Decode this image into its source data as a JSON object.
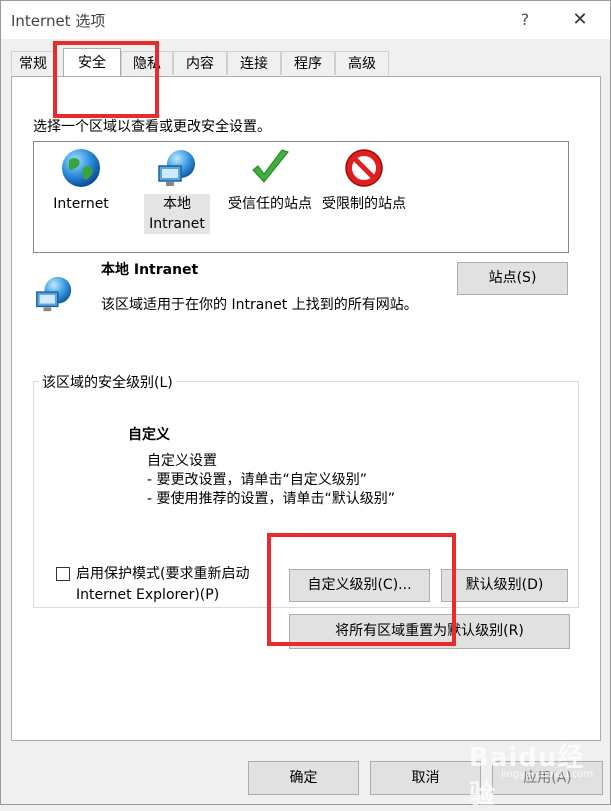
{
  "window": {
    "title": "Internet 选项",
    "help_glyph": "?",
    "close_glyph": "✕"
  },
  "tabs": [
    {
      "label": "常规"
    },
    {
      "label": "安全"
    },
    {
      "label": "隐私"
    },
    {
      "label": "内容"
    },
    {
      "label": "连接"
    },
    {
      "label": "程序"
    },
    {
      "label": "高级"
    }
  ],
  "security": {
    "instruction": "选择一个区域以查看或更改安全设置。",
    "zones": [
      {
        "label": "Internet",
        "icon": "globe-icon"
      },
      {
        "label_line1": "本地",
        "label_line2": "Intranet",
        "icon": "network-globe-icon"
      },
      {
        "label": "受信任的站点",
        "icon": "checkmark-icon"
      },
      {
        "label": "受限制的站点",
        "icon": "restricted-icon"
      }
    ],
    "selected_zone": {
      "name": "本地 Intranet",
      "description": "该区域适用于在你的 Intranet 上找到的所有网站。",
      "sites_button": "站点(S)"
    },
    "level_group": {
      "label": "该区域的安全级别(L)",
      "level_name": "自定义",
      "lines": [
        "自定义设置",
        "- 要更改设置，请单击“自定义级别”",
        "- 要使用推荐的设置，请单击“默认级别”"
      ]
    },
    "protected_mode": {
      "checked": false,
      "label_line1": "启用保护模式(要求重新启动",
      "label_line2": "Internet Explorer)(P)"
    },
    "custom_level_button": "自定义级别(C)...",
    "default_level_button": "默认级别(D)",
    "reset_all_button": "将所有区域重置为默认级别(R)"
  },
  "footer": {
    "ok": "确定",
    "cancel": "取消",
    "apply": "应用(A)"
  },
  "watermark": {
    "text": "Baidu经验",
    "sub": "jingyan.baidu.com"
  },
  "colors": {
    "highlight": "#e82c2c",
    "button_bg": "#e1e1e1"
  }
}
